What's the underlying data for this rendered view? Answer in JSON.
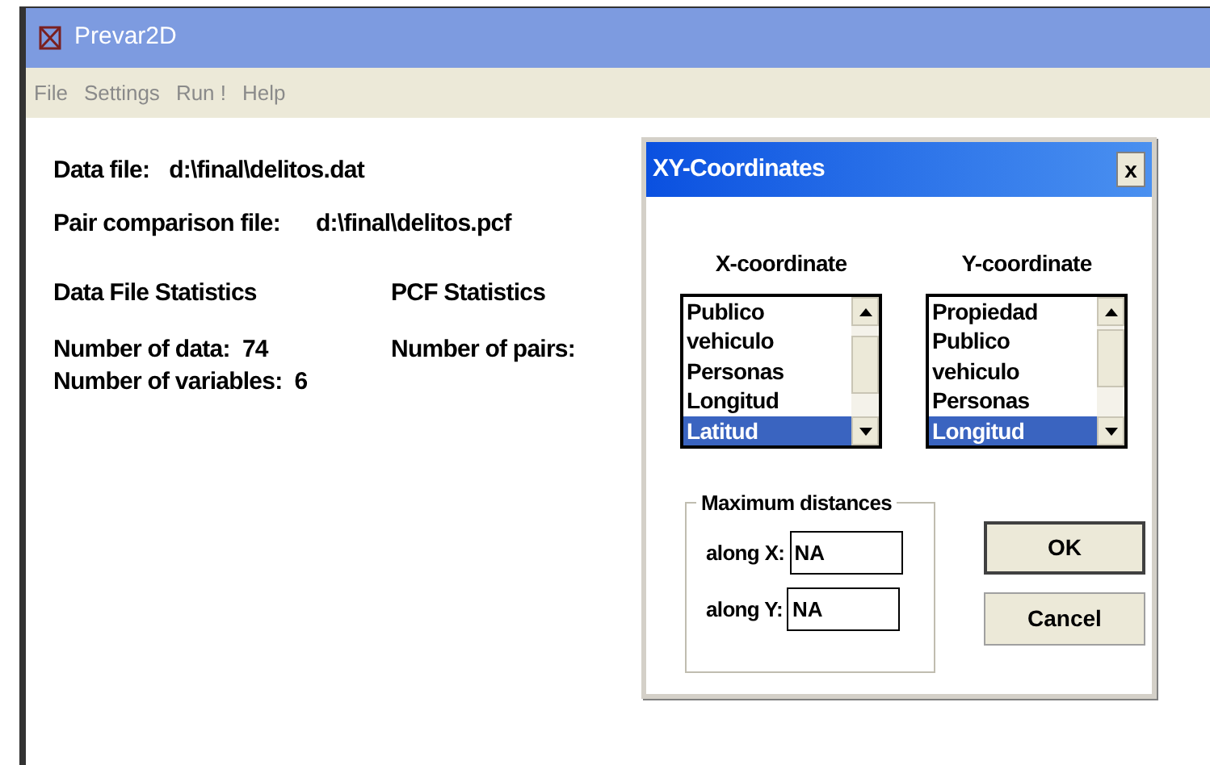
{
  "window": {
    "title": "Prevar2D"
  },
  "menu": [
    "File",
    "Settings",
    "Run !",
    "Help"
  ],
  "data_file": {
    "label": "Data file:",
    "value": "d:\\final\\delitos.dat"
  },
  "pair_file": {
    "label": "Pair comparison file:",
    "value": "d:\\final\\delitos.pcf"
  },
  "data_stats": {
    "heading": "Data File Statistics",
    "lines": [
      "Number of data:  74",
      "Number of variables:  6"
    ]
  },
  "pcf_stats": {
    "heading": "PCF Statistics",
    "lines": [
      "Number of pairs:"
    ]
  },
  "dialog": {
    "title": "XY-Coordinates",
    "close": "x",
    "lists": [
      {
        "heading": "X-coordinate",
        "items": [
          {
            "label": "Publico",
            "selected": false
          },
          {
            "label": "vehiculo",
            "selected": false
          },
          {
            "label": "Personas",
            "selected": false
          },
          {
            "label": "Longitud",
            "selected": false
          },
          {
            "label": "Latitud",
            "selected": true
          }
        ]
      },
      {
        "heading": "Y-coordinate",
        "items": [
          {
            "label": "Propiedad",
            "selected": false
          },
          {
            "label": "Publico",
            "selected": false
          },
          {
            "label": "vehiculo",
            "selected": false
          },
          {
            "label": "Personas",
            "selected": false
          },
          {
            "label": "Longitud",
            "selected": true
          }
        ]
      }
    ],
    "group": {
      "title": "Maximum distances",
      "fields": [
        {
          "label": "along X:",
          "value": "NA"
        },
        {
          "label": "along Y:",
          "value": "NA"
        }
      ]
    },
    "buttons": [
      "OK",
      "Cancel"
    ]
  }
}
